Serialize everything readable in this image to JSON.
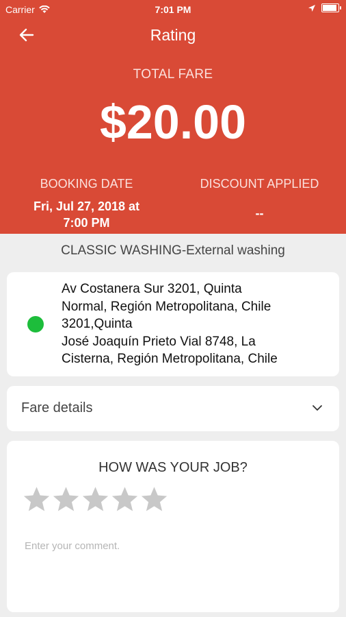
{
  "status": {
    "carrier": "Carrier",
    "time": "7:01 PM"
  },
  "nav": {
    "title": "Rating"
  },
  "fare": {
    "label": "TOTAL FARE",
    "value": "$20.00"
  },
  "booking": {
    "label": "BOOKING DATE",
    "line1": "Fri, Jul 27, 2018 at",
    "line2": "7:00 PM"
  },
  "discount": {
    "label": "DISCOUNT APPLIED",
    "value": "--"
  },
  "service": "CLASSIC WASHING-External washing",
  "address": {
    "lines": [
      "Av Costanera Sur 3201, Quinta",
      "Normal, Región Metropolitana, Chile",
      "3201,Quinta",
      "José Joaquín Prieto Vial 8748,  La",
      "Cisterna,  Región Metropolitana,  Chile"
    ]
  },
  "fare_details": {
    "label": "Fare details"
  },
  "rating": {
    "question": "HOW WAS YOUR JOB?",
    "stars_total": 5,
    "stars_selected": 0,
    "comment_placeholder": "Enter your comment."
  },
  "colors": {
    "header": "#d94a36",
    "dot": "#1dbd3b",
    "star": "#c8c8c8"
  }
}
